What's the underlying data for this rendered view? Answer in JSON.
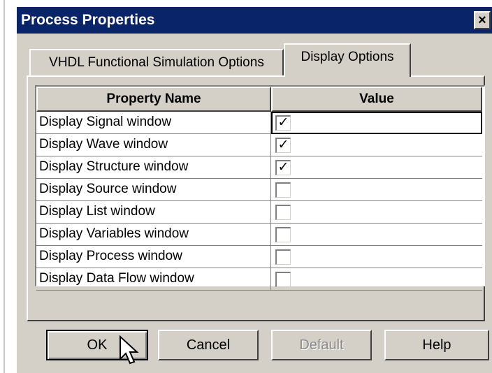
{
  "dialog": {
    "title": "Process Properties",
    "close_label": "×"
  },
  "tabs": [
    {
      "label": "VHDL Functional Simulation Options",
      "active": false
    },
    {
      "label": "Display Options",
      "active": true
    }
  ],
  "grid": {
    "headers": {
      "name": "Property Name",
      "value": "Value"
    },
    "rows": [
      {
        "name": "Display Signal window",
        "checked": true,
        "mark": "✓"
      },
      {
        "name": "Display Wave window",
        "checked": true,
        "mark": "✓"
      },
      {
        "name": "Display Structure window",
        "checked": true,
        "mark": "✓"
      },
      {
        "name": "Display Source window",
        "checked": false,
        "mark": ""
      },
      {
        "name": "Display List window",
        "checked": false,
        "mark": ""
      },
      {
        "name": "Display Variables window",
        "checked": false,
        "mark": ""
      },
      {
        "name": "Display Process window",
        "checked": false,
        "mark": ""
      },
      {
        "name": "Display Data Flow window",
        "checked": false,
        "mark": ""
      }
    ]
  },
  "buttons": {
    "ok": "OK",
    "cancel": "Cancel",
    "default": "Default",
    "help": "Help"
  },
  "icons": {
    "close": "close-icon",
    "cursor": "mouse-pointer-icon"
  }
}
